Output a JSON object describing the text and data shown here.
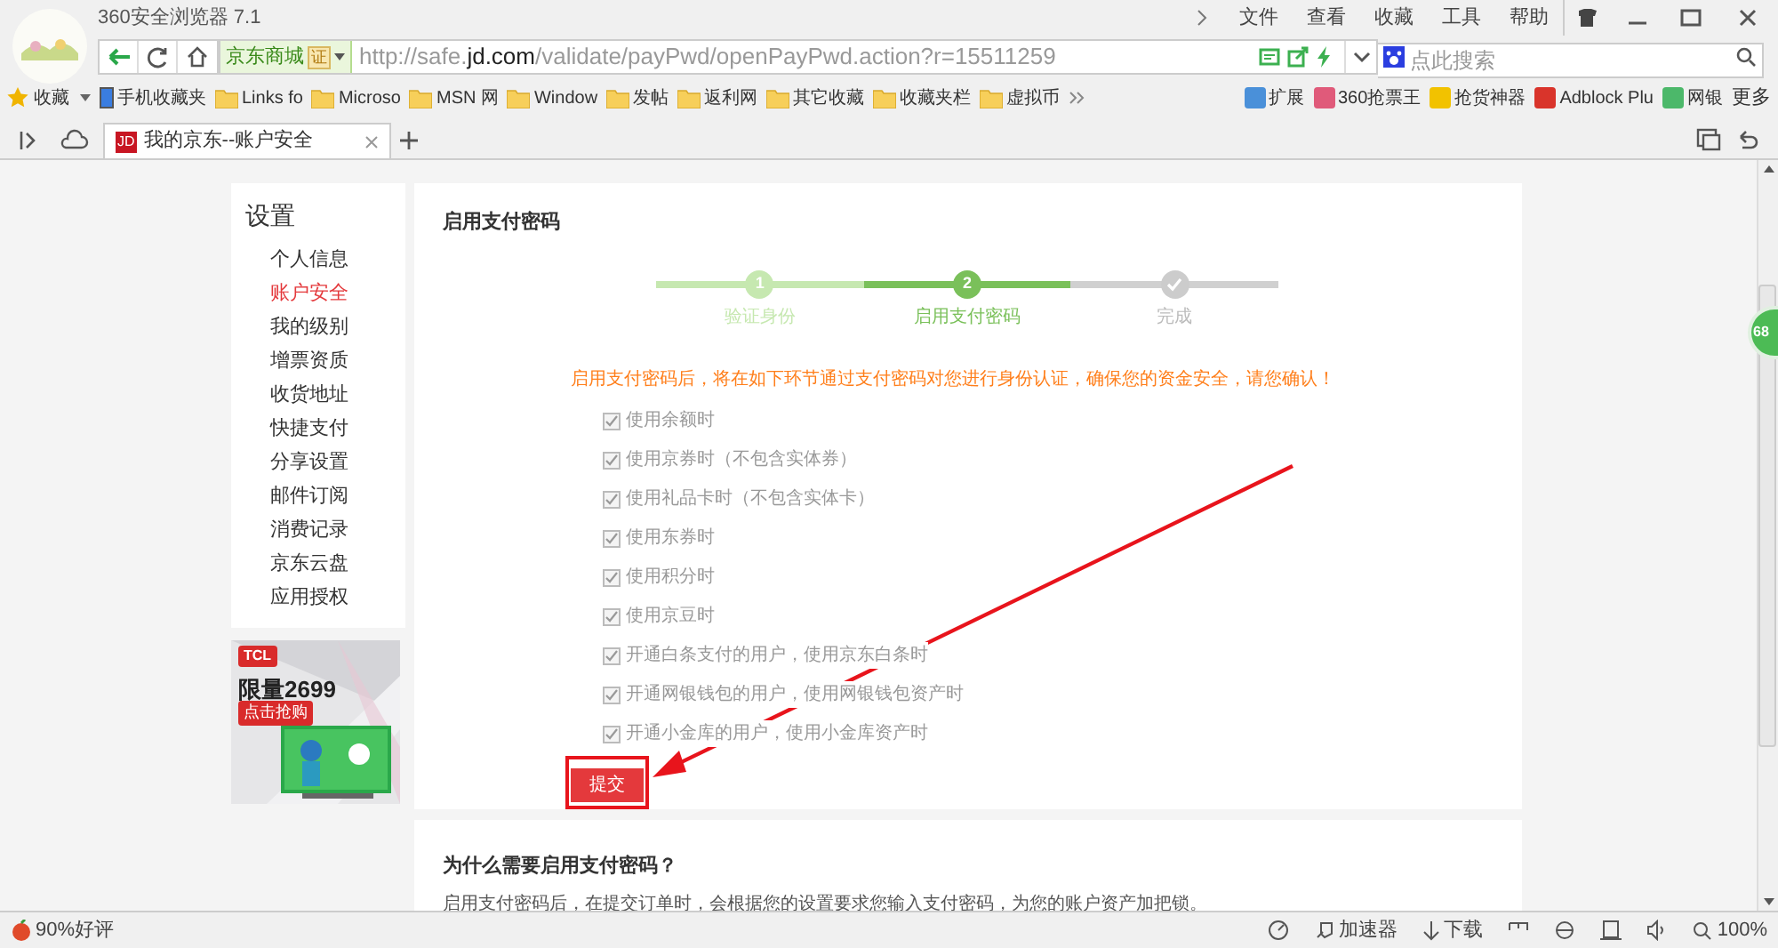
{
  "window": {
    "title": "360安全浏览器 7.1",
    "menu": [
      "文件",
      "查看",
      "收藏",
      "工具",
      "帮助"
    ]
  },
  "address_bar": {
    "site_label": "京东商城",
    "cert_badge": "证",
    "url_host_prefix": "http://safe.",
    "url_host": "jd.com",
    "url_path": "/validate/payPwd/openPayPwd.action?r=15511259",
    "search_placeholder": "点此搜索"
  },
  "bookmarks": [
    {
      "label": "收藏",
      "kind": "star"
    },
    {
      "label": "手机收藏夹",
      "kind": "phone"
    },
    {
      "label": "Links fo",
      "kind": "folder"
    },
    {
      "label": "Microso",
      "kind": "folder"
    },
    {
      "label": "MSN 网",
      "kind": "folder"
    },
    {
      "label": "Window",
      "kind": "folder"
    },
    {
      "label": "发帖",
      "kind": "folder"
    },
    {
      "label": "返利网",
      "kind": "folder"
    },
    {
      "label": "其它收藏",
      "kind": "folder"
    },
    {
      "label": "收藏夹栏",
      "kind": "folder"
    },
    {
      "label": "虚拟币",
      "kind": "folder"
    }
  ],
  "extensions": [
    {
      "label": "扩展",
      "color": "#4a90d9"
    },
    {
      "label": "360抢票王",
      "color": "#e05a7a"
    },
    {
      "label": "抢货神器",
      "color": "#f2c200"
    },
    {
      "label": "Adblock Plu",
      "color": "#d9342b"
    },
    {
      "label": "网银",
      "color": "#4cb86a"
    }
  ],
  "more_label": "更多",
  "tabs": [
    {
      "favicon": "JD",
      "label": "我的京东--账户安全",
      "selected": true
    }
  ],
  "sidebar": {
    "title": "设置",
    "items": [
      {
        "label": "个人信息",
        "selected": false
      },
      {
        "label": "账户安全",
        "selected": true
      },
      {
        "label": "我的级别",
        "selected": false
      },
      {
        "label": "增票资质",
        "selected": false
      },
      {
        "label": "收货地址",
        "selected": false
      },
      {
        "label": "快捷支付",
        "selected": false
      },
      {
        "label": "分享设置",
        "selected": false
      },
      {
        "label": "邮件订阅",
        "selected": false
      },
      {
        "label": "消费记录",
        "selected": false
      },
      {
        "label": "京东云盘",
        "selected": false
      },
      {
        "label": "应用授权",
        "selected": false
      }
    ]
  },
  "ad": {
    "brand": "TCL",
    "headline": "限量2699",
    "cta": "点击抢购"
  },
  "main": {
    "title": "启用支付密码",
    "steps": [
      {
        "number": "1",
        "label": "验证身份",
        "done": true,
        "selected": false
      },
      {
        "number": "2",
        "label": "启用支付密码",
        "done": false,
        "selected": true
      },
      {
        "label": "完成",
        "done": false,
        "selected": false
      }
    ],
    "notice": "启用支付密码后，将在如下环节通过支付密码对您进行身份认证，确保您的资金安全，请您确认！",
    "options": [
      {
        "label": "使用余额时",
        "checked": true
      },
      {
        "label": "使用京券时（不包含实体券）",
        "checked": true
      },
      {
        "label": "使用礼品卡时（不包含实体卡）",
        "checked": true
      },
      {
        "label": "使用东券时",
        "checked": true
      },
      {
        "label": "使用积分时",
        "checked": true
      },
      {
        "label": "使用京豆时",
        "checked": true
      },
      {
        "label": "开通白条支付的用户，使用京东白条时",
        "checked": true
      },
      {
        "label": "开通网银钱包的用户，使用网银钱包资产时",
        "checked": true
      },
      {
        "label": "开通小金库的用户，使用小金库资产时",
        "checked": true
      }
    ],
    "submit": "提交"
  },
  "faq": {
    "title": "为什么需要启用支付密码？",
    "text": "启用支付密码后，在提交订单时，会根据您的设置要求您输入支付密码，为您的账户资产加把锁。"
  },
  "float_badge": "68",
  "status_bar": {
    "rating": "90%好评",
    "accelerator": "加速器",
    "download": "下载",
    "zoom": "100%"
  }
}
